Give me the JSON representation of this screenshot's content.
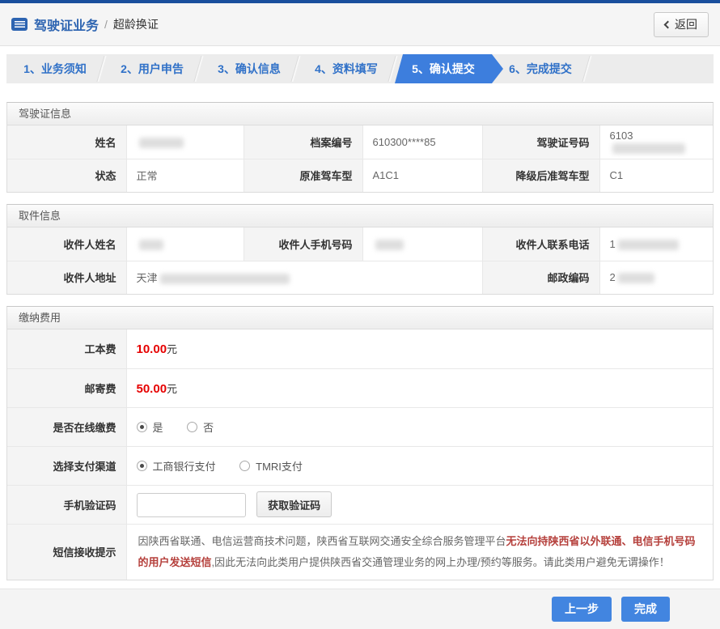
{
  "colors": {
    "top_bar": "#1a4f9d",
    "brand_blue": "#2d64b1",
    "step_active": "#3d7edd",
    "button_blue": "#4285e0",
    "fee_red": "#e60000",
    "notice_red": "#c1504c"
  },
  "header": {
    "title": "驾驶证业务",
    "separator": "/",
    "subtitle": "超龄换证",
    "back_label": "返回"
  },
  "steps": {
    "items": [
      {
        "label": "1、业务须知",
        "active": false
      },
      {
        "label": "2、用户申告",
        "active": false
      },
      {
        "label": "3、确认信息",
        "active": false
      },
      {
        "label": "4、资料填写",
        "active": false
      },
      {
        "label": "5、确认提交",
        "active": true
      },
      {
        "label": "6、完成提交",
        "active": false
      }
    ]
  },
  "license": {
    "title": "驾驶证信息",
    "name_label": "姓名",
    "file_label": "档案编号",
    "file_value": "610300****85",
    "number_label": "驾驶证号码",
    "number_prefix": "6103",
    "status_label": "状态",
    "status_value": "正常",
    "class_label": "原准驾车型",
    "class_value": "A1C1",
    "downgrade_label": "降级后准驾车型",
    "downgrade_value": "C1"
  },
  "pickup": {
    "title": "取件信息",
    "name_label": "收件人姓名",
    "mobile_label": "收件人手机号码",
    "tel_label": "收件人联系电话",
    "tel_prefix": "1",
    "address_label": "收件人地址",
    "address_prefix": "天津",
    "postcode_label": "邮政编码",
    "postcode_prefix": "2"
  },
  "payment": {
    "title": "缴纳费用",
    "fee_label": "工本费",
    "fee_value": "10.00",
    "postage_label": "邮寄费",
    "postage_value": "50.00",
    "unit": "元",
    "online_label": "是否在线缴费",
    "yes_label": "是",
    "no_label": "否",
    "online_selected": "是",
    "channel_label": "选择支付渠道",
    "channel_icbc": "工商银行支付",
    "channel_tmri": "TMRI支付",
    "channel_selected": "工商银行支付",
    "code_label": "手机验证码",
    "code_button": "获取验证码",
    "notice_label": "短信接收提示",
    "notice_part1": "因陕西省联通、电信运营商技术问题，陕西省互联网交通安全综合服务管理平台",
    "notice_part2": "无法向持陕西省以外联通、电信手机号码的用户发送短信",
    "notice_part3": ",因此无法向此类用户提供陕西省交通管理业务的网上办理/预约等服务。请此类用户避免无谓操作！"
  },
  "footer": {
    "prev_label": "上一步",
    "finish_label": "完成"
  }
}
